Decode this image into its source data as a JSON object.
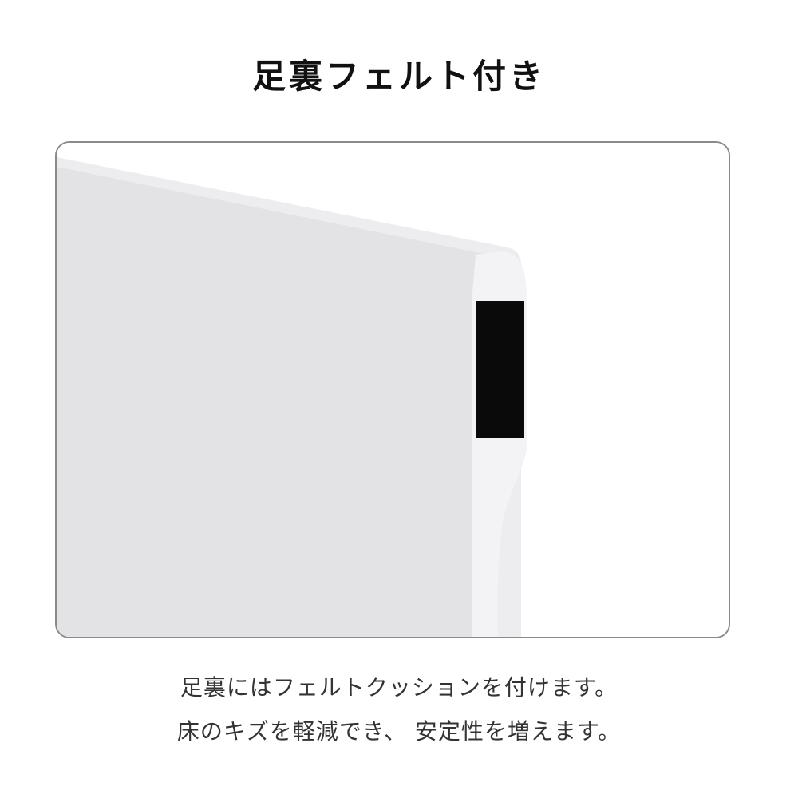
{
  "title": "足裏フェルト付き",
  "image": {
    "description_icon": "table-leg-felt-illustration",
    "colors": {
      "panel": "#e3e3e5",
      "edge": "#f4f4f6",
      "leg": "#f2f2f4",
      "felt": "#0a0a0a",
      "border": "#8a8a8a"
    }
  },
  "caption": {
    "line1": "足裏にはフェルトクッションを付けます。",
    "line2": "床のキズを軽減でき、 安定性を増えます。"
  }
}
